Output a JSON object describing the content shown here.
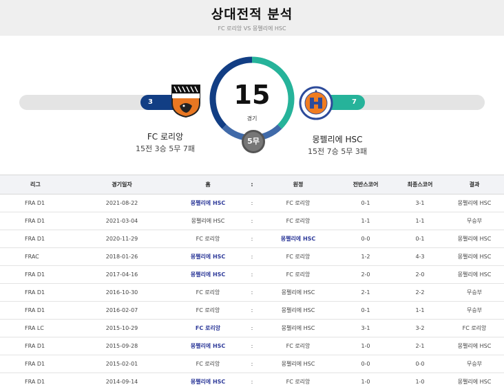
{
  "header": {
    "title": "상대전적 분석",
    "subtitle": "FC 로리앙 VS 몽펠리에 HSC"
  },
  "summary": {
    "total_games": "15",
    "games_label": "경기",
    "draws_label": "5무",
    "home_team": {
      "name": "FC 로리앙",
      "record": "15전 3승 5무 7패",
      "wins": "3",
      "win_share": 0.2
    },
    "away_team": {
      "name": "몽펠리에 HSC",
      "record": "15전 7승 5무 3패",
      "wins": "7",
      "win_share": 0.47
    },
    "colors": {
      "home": "#123e84",
      "away": "#26b39a",
      "draw": "#777777"
    }
  },
  "table": {
    "headers": [
      "리그",
      "경기일자",
      "홈",
      ":",
      "원정",
      "전반스코어",
      "최종스코어",
      "결과"
    ],
    "rows": [
      [
        "FRA D1",
        "2021-08-22",
        "몽펠리에 HSC",
        ":",
        "FC 로리앙",
        "0-1",
        "3-1",
        "몽펠리에 HSC"
      ],
      [
        "FRA D1",
        "2021-03-04",
        "몽펠리에 HSC",
        ":",
        "FC 로리앙",
        "1-1",
        "1-1",
        "무승부"
      ],
      [
        "FRA D1",
        "2020-11-29",
        "FC 로리앙",
        ":",
        "몽펠리에 HSC",
        "0-0",
        "0-1",
        "몽펠리에 HSC"
      ],
      [
        "FRAC",
        "2018-01-26",
        "몽펠리에 HSC",
        ":",
        "FC 로리앙",
        "1-2",
        "4-3",
        "몽펠리에 HSC"
      ],
      [
        "FRA D1",
        "2017-04-16",
        "몽펠리에 HSC",
        ":",
        "FC 로리앙",
        "2-0",
        "2-0",
        "몽펠리에 HSC"
      ],
      [
        "FRA D1",
        "2016-10-30",
        "FC 로리앙",
        ":",
        "몽펠리에 HSC",
        "2-1",
        "2-2",
        "무승부"
      ],
      [
        "FRA D1",
        "2016-02-07",
        "FC 로리앙",
        ":",
        "몽펠리에 HSC",
        "0-1",
        "1-1",
        "무승부"
      ],
      [
        "FRA LC",
        "2015-10-29",
        "FC 로리앙",
        ":",
        "몽펠리에 HSC",
        "3-1",
        "3-2",
        "FC 로리앙"
      ],
      [
        "FRA D1",
        "2015-09-28",
        "몽펠리에 HSC",
        ":",
        "FC 로리앙",
        "1-0",
        "2-1",
        "몽펠리에 HSC"
      ],
      [
        "FRA D1",
        "2015-02-01",
        "FC 로리앙",
        ":",
        "몽펠리에 HSC",
        "0-0",
        "0-0",
        "무승부"
      ],
      [
        "FRA D1",
        "2014-09-14",
        "몽펠리에 HSC",
        ":",
        "FC 로리앙",
        "1-0",
        "1-0",
        "몽펠리에 HSC"
      ]
    ],
    "highlight_cells": [
      [
        0,
        2
      ],
      [
        2,
        4
      ],
      [
        3,
        2
      ],
      [
        4,
        2
      ],
      [
        7,
        2
      ],
      [
        8,
        2
      ],
      [
        10,
        2
      ]
    ]
  }
}
